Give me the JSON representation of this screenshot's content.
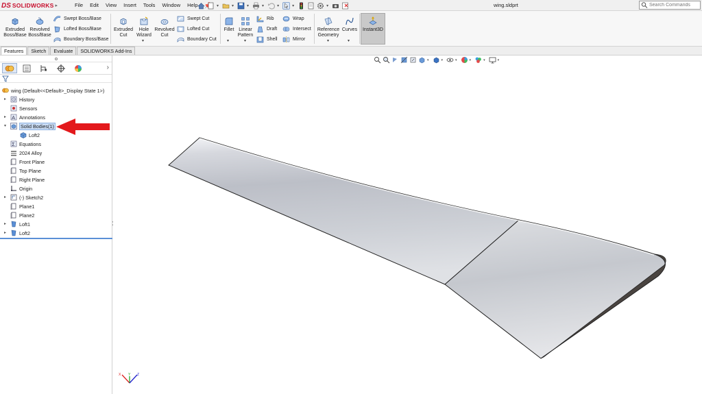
{
  "app": {
    "brand_ds": "DS",
    "brand_name": "SOLIDWORKS",
    "document_title": "wing.sldprt",
    "menu": [
      "File",
      "Edit",
      "View",
      "Insert",
      "Tools",
      "Window",
      "Help"
    ],
    "search_placeholder": "Search Commands"
  },
  "ribbon": {
    "extruded_boss": [
      "Extruded",
      "Boss/Base"
    ],
    "revolved_boss": [
      "Revolved",
      "Boss/Base"
    ],
    "swept_boss": "Swept Boss/Base",
    "lofted_boss": "Lofted Boss/Base",
    "boundary_boss": "Boundary Boss/Base",
    "extruded_cut": [
      "Extruded",
      "Cut"
    ],
    "hole_wizard": [
      "Hole",
      "Wizard"
    ],
    "revolved_cut": [
      "Revolved",
      "Cut"
    ],
    "swept_cut": "Swept Cut",
    "lofted_cut": "Lofted Cut",
    "boundary_cut": "Boundary Cut",
    "fillet": "Fillet",
    "linear_pattern": [
      "Linear",
      "Pattern"
    ],
    "rib": "Rib",
    "draft": "Draft",
    "shell": "Shell",
    "wrap": "Wrap",
    "intersect": "Intersect",
    "mirror": "Mirror",
    "reference_geometry": [
      "Reference",
      "Geometry"
    ],
    "curves": "Curves",
    "instant3d": "Instant3D"
  },
  "tabs": [
    {
      "label": "Features",
      "active": true
    },
    {
      "label": "Sketch",
      "active": false
    },
    {
      "label": "Evaluate",
      "active": false
    },
    {
      "label": "SOLIDWORKS Add-Ins",
      "active": false
    }
  ],
  "tree": {
    "root": "wing  (Default<<Default>_Display State 1>)",
    "items": [
      {
        "label": "History",
        "icon": "history-icon",
        "expandable": true
      },
      {
        "label": "Sensors",
        "icon": "sensors-icon",
        "expandable": false
      },
      {
        "label": "Annotations",
        "icon": "annotations-icon",
        "expandable": true
      },
      {
        "label": "Solid Bodies(1)",
        "icon": "solid-bodies-icon",
        "expandable": true,
        "expanded": true,
        "selected": true
      },
      {
        "label": "Loft2",
        "icon": "body-icon",
        "child": true
      },
      {
        "label": "Equations",
        "icon": "equations-icon",
        "expandable": false
      },
      {
        "label": "2024 Alloy",
        "icon": "material-icon",
        "expandable": false
      },
      {
        "label": "Front Plane",
        "icon": "plane-icon",
        "expandable": false
      },
      {
        "label": "Top Plane",
        "icon": "plane-icon",
        "expandable": false
      },
      {
        "label": "Right Plane",
        "icon": "plane-icon",
        "expandable": false
      },
      {
        "label": "Origin",
        "icon": "origin-icon",
        "expandable": false
      },
      {
        "label": "(-) Sketch2",
        "icon": "sketch-icon",
        "expandable": true
      },
      {
        "label": "Plane1",
        "icon": "plane-icon",
        "expandable": false
      },
      {
        "label": "Plane2",
        "icon": "plane-icon",
        "expandable": false
      },
      {
        "label": "Loft1",
        "icon": "loft-icon",
        "expandable": true
      },
      {
        "label": "Loft2",
        "icon": "loft-icon",
        "expandable": true
      }
    ]
  },
  "colors": {
    "brand": "#c8102e",
    "annotation_arrow": "#e3191c",
    "selection": "#c9dcf5",
    "wing_shadow": "#4a4440"
  }
}
